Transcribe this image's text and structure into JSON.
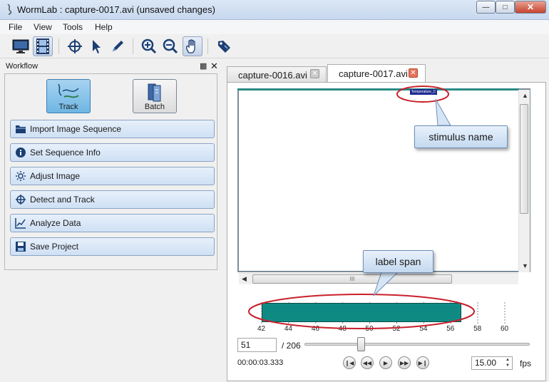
{
  "window": {
    "title": "WormLab : capture-0017.avi (unsaved changes)"
  },
  "menu": [
    "File",
    "View",
    "Tools",
    "Help"
  ],
  "toolbar": {
    "icons": [
      "monitor-icon",
      "film-icon",
      "crosshair-icon",
      "pointer-icon",
      "pen-icon",
      "zoom-in-icon",
      "zoom-out-icon",
      "hand-icon",
      "tag-icon"
    ],
    "active": [
      "film-icon",
      "hand-icon"
    ]
  },
  "workflow": {
    "title": "Workflow",
    "modes": {
      "track": "Track",
      "batch": "Batch"
    },
    "steps": [
      "Import Image Sequence",
      "Set Sequence Info",
      "Adjust Image",
      "Detect and Track",
      "Analyze Data",
      "Save Project"
    ]
  },
  "tabs": [
    {
      "label": "capture-0016.avi",
      "active": false
    },
    {
      "label": "capture-0017.avi",
      "active": true
    }
  ],
  "viewer": {
    "stimulus_label": "Temperature_C"
  },
  "scrollbar": {
    "grip": "III"
  },
  "callouts": {
    "stimulus": "stimulus name",
    "span": "label span"
  },
  "timeline": {
    "ticks": [
      "42",
      "44",
      "46",
      "48",
      "50",
      "52",
      "54",
      "56",
      "58",
      "60"
    ],
    "label_span": {
      "start": 42,
      "end": 56.8
    }
  },
  "player": {
    "frame": "51",
    "total": "/ 206",
    "position": 0.25,
    "time": "00:00:03.333",
    "fps": "15.00",
    "fps_label": "fps"
  },
  "colors": {
    "accent": "#0f8a83",
    "callout_border": "#c8202c",
    "tab_close": "#e8735a"
  }
}
